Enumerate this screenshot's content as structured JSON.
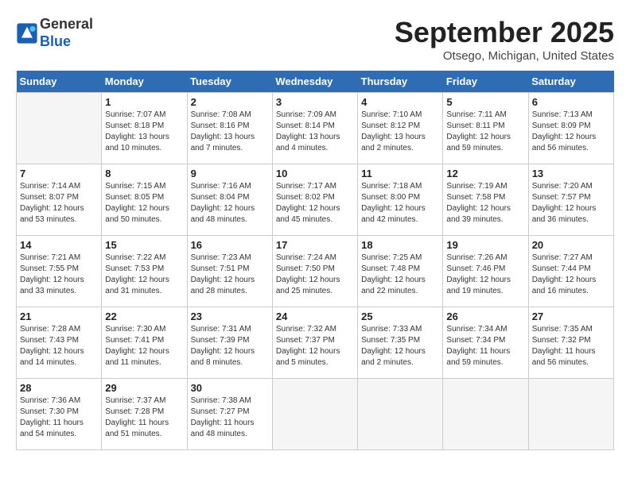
{
  "logo": {
    "general": "General",
    "blue": "Blue"
  },
  "title": {
    "month": "September 2025",
    "location": "Otsego, Michigan, United States"
  },
  "headers": [
    "Sunday",
    "Monday",
    "Tuesday",
    "Wednesday",
    "Thursday",
    "Friday",
    "Saturday"
  ],
  "weeks": [
    [
      {
        "day": "",
        "info": ""
      },
      {
        "day": "1",
        "info": "Sunrise: 7:07 AM\nSunset: 8:18 PM\nDaylight: 13 hours\nand 10 minutes."
      },
      {
        "day": "2",
        "info": "Sunrise: 7:08 AM\nSunset: 8:16 PM\nDaylight: 13 hours\nand 7 minutes."
      },
      {
        "day": "3",
        "info": "Sunrise: 7:09 AM\nSunset: 8:14 PM\nDaylight: 13 hours\nand 4 minutes."
      },
      {
        "day": "4",
        "info": "Sunrise: 7:10 AM\nSunset: 8:12 PM\nDaylight: 13 hours\nand 2 minutes."
      },
      {
        "day": "5",
        "info": "Sunrise: 7:11 AM\nSunset: 8:11 PM\nDaylight: 12 hours\nand 59 minutes."
      },
      {
        "day": "6",
        "info": "Sunrise: 7:13 AM\nSunset: 8:09 PM\nDaylight: 12 hours\nand 56 minutes."
      }
    ],
    [
      {
        "day": "7",
        "info": "Sunrise: 7:14 AM\nSunset: 8:07 PM\nDaylight: 12 hours\nand 53 minutes."
      },
      {
        "day": "8",
        "info": "Sunrise: 7:15 AM\nSunset: 8:05 PM\nDaylight: 12 hours\nand 50 minutes."
      },
      {
        "day": "9",
        "info": "Sunrise: 7:16 AM\nSunset: 8:04 PM\nDaylight: 12 hours\nand 48 minutes."
      },
      {
        "day": "10",
        "info": "Sunrise: 7:17 AM\nSunset: 8:02 PM\nDaylight: 12 hours\nand 45 minutes."
      },
      {
        "day": "11",
        "info": "Sunrise: 7:18 AM\nSunset: 8:00 PM\nDaylight: 12 hours\nand 42 minutes."
      },
      {
        "day": "12",
        "info": "Sunrise: 7:19 AM\nSunset: 7:58 PM\nDaylight: 12 hours\nand 39 minutes."
      },
      {
        "day": "13",
        "info": "Sunrise: 7:20 AM\nSunset: 7:57 PM\nDaylight: 12 hours\nand 36 minutes."
      }
    ],
    [
      {
        "day": "14",
        "info": "Sunrise: 7:21 AM\nSunset: 7:55 PM\nDaylight: 12 hours\nand 33 minutes."
      },
      {
        "day": "15",
        "info": "Sunrise: 7:22 AM\nSunset: 7:53 PM\nDaylight: 12 hours\nand 31 minutes."
      },
      {
        "day": "16",
        "info": "Sunrise: 7:23 AM\nSunset: 7:51 PM\nDaylight: 12 hours\nand 28 minutes."
      },
      {
        "day": "17",
        "info": "Sunrise: 7:24 AM\nSunset: 7:50 PM\nDaylight: 12 hours\nand 25 minutes."
      },
      {
        "day": "18",
        "info": "Sunrise: 7:25 AM\nSunset: 7:48 PM\nDaylight: 12 hours\nand 22 minutes."
      },
      {
        "day": "19",
        "info": "Sunrise: 7:26 AM\nSunset: 7:46 PM\nDaylight: 12 hours\nand 19 minutes."
      },
      {
        "day": "20",
        "info": "Sunrise: 7:27 AM\nSunset: 7:44 PM\nDaylight: 12 hours\nand 16 minutes."
      }
    ],
    [
      {
        "day": "21",
        "info": "Sunrise: 7:28 AM\nSunset: 7:43 PM\nDaylight: 12 hours\nand 14 minutes."
      },
      {
        "day": "22",
        "info": "Sunrise: 7:30 AM\nSunset: 7:41 PM\nDaylight: 12 hours\nand 11 minutes."
      },
      {
        "day": "23",
        "info": "Sunrise: 7:31 AM\nSunset: 7:39 PM\nDaylight: 12 hours\nand 8 minutes."
      },
      {
        "day": "24",
        "info": "Sunrise: 7:32 AM\nSunset: 7:37 PM\nDaylight: 12 hours\nand 5 minutes."
      },
      {
        "day": "25",
        "info": "Sunrise: 7:33 AM\nSunset: 7:35 PM\nDaylight: 12 hours\nand 2 minutes."
      },
      {
        "day": "26",
        "info": "Sunrise: 7:34 AM\nSunset: 7:34 PM\nDaylight: 11 hours\nand 59 minutes."
      },
      {
        "day": "27",
        "info": "Sunrise: 7:35 AM\nSunset: 7:32 PM\nDaylight: 11 hours\nand 56 minutes."
      }
    ],
    [
      {
        "day": "28",
        "info": "Sunrise: 7:36 AM\nSunset: 7:30 PM\nDaylight: 11 hours\nand 54 minutes."
      },
      {
        "day": "29",
        "info": "Sunrise: 7:37 AM\nSunset: 7:28 PM\nDaylight: 11 hours\nand 51 minutes."
      },
      {
        "day": "30",
        "info": "Sunrise: 7:38 AM\nSunset: 7:27 PM\nDaylight: 11 hours\nand 48 minutes."
      },
      {
        "day": "",
        "info": ""
      },
      {
        "day": "",
        "info": ""
      },
      {
        "day": "",
        "info": ""
      },
      {
        "day": "",
        "info": ""
      }
    ]
  ]
}
